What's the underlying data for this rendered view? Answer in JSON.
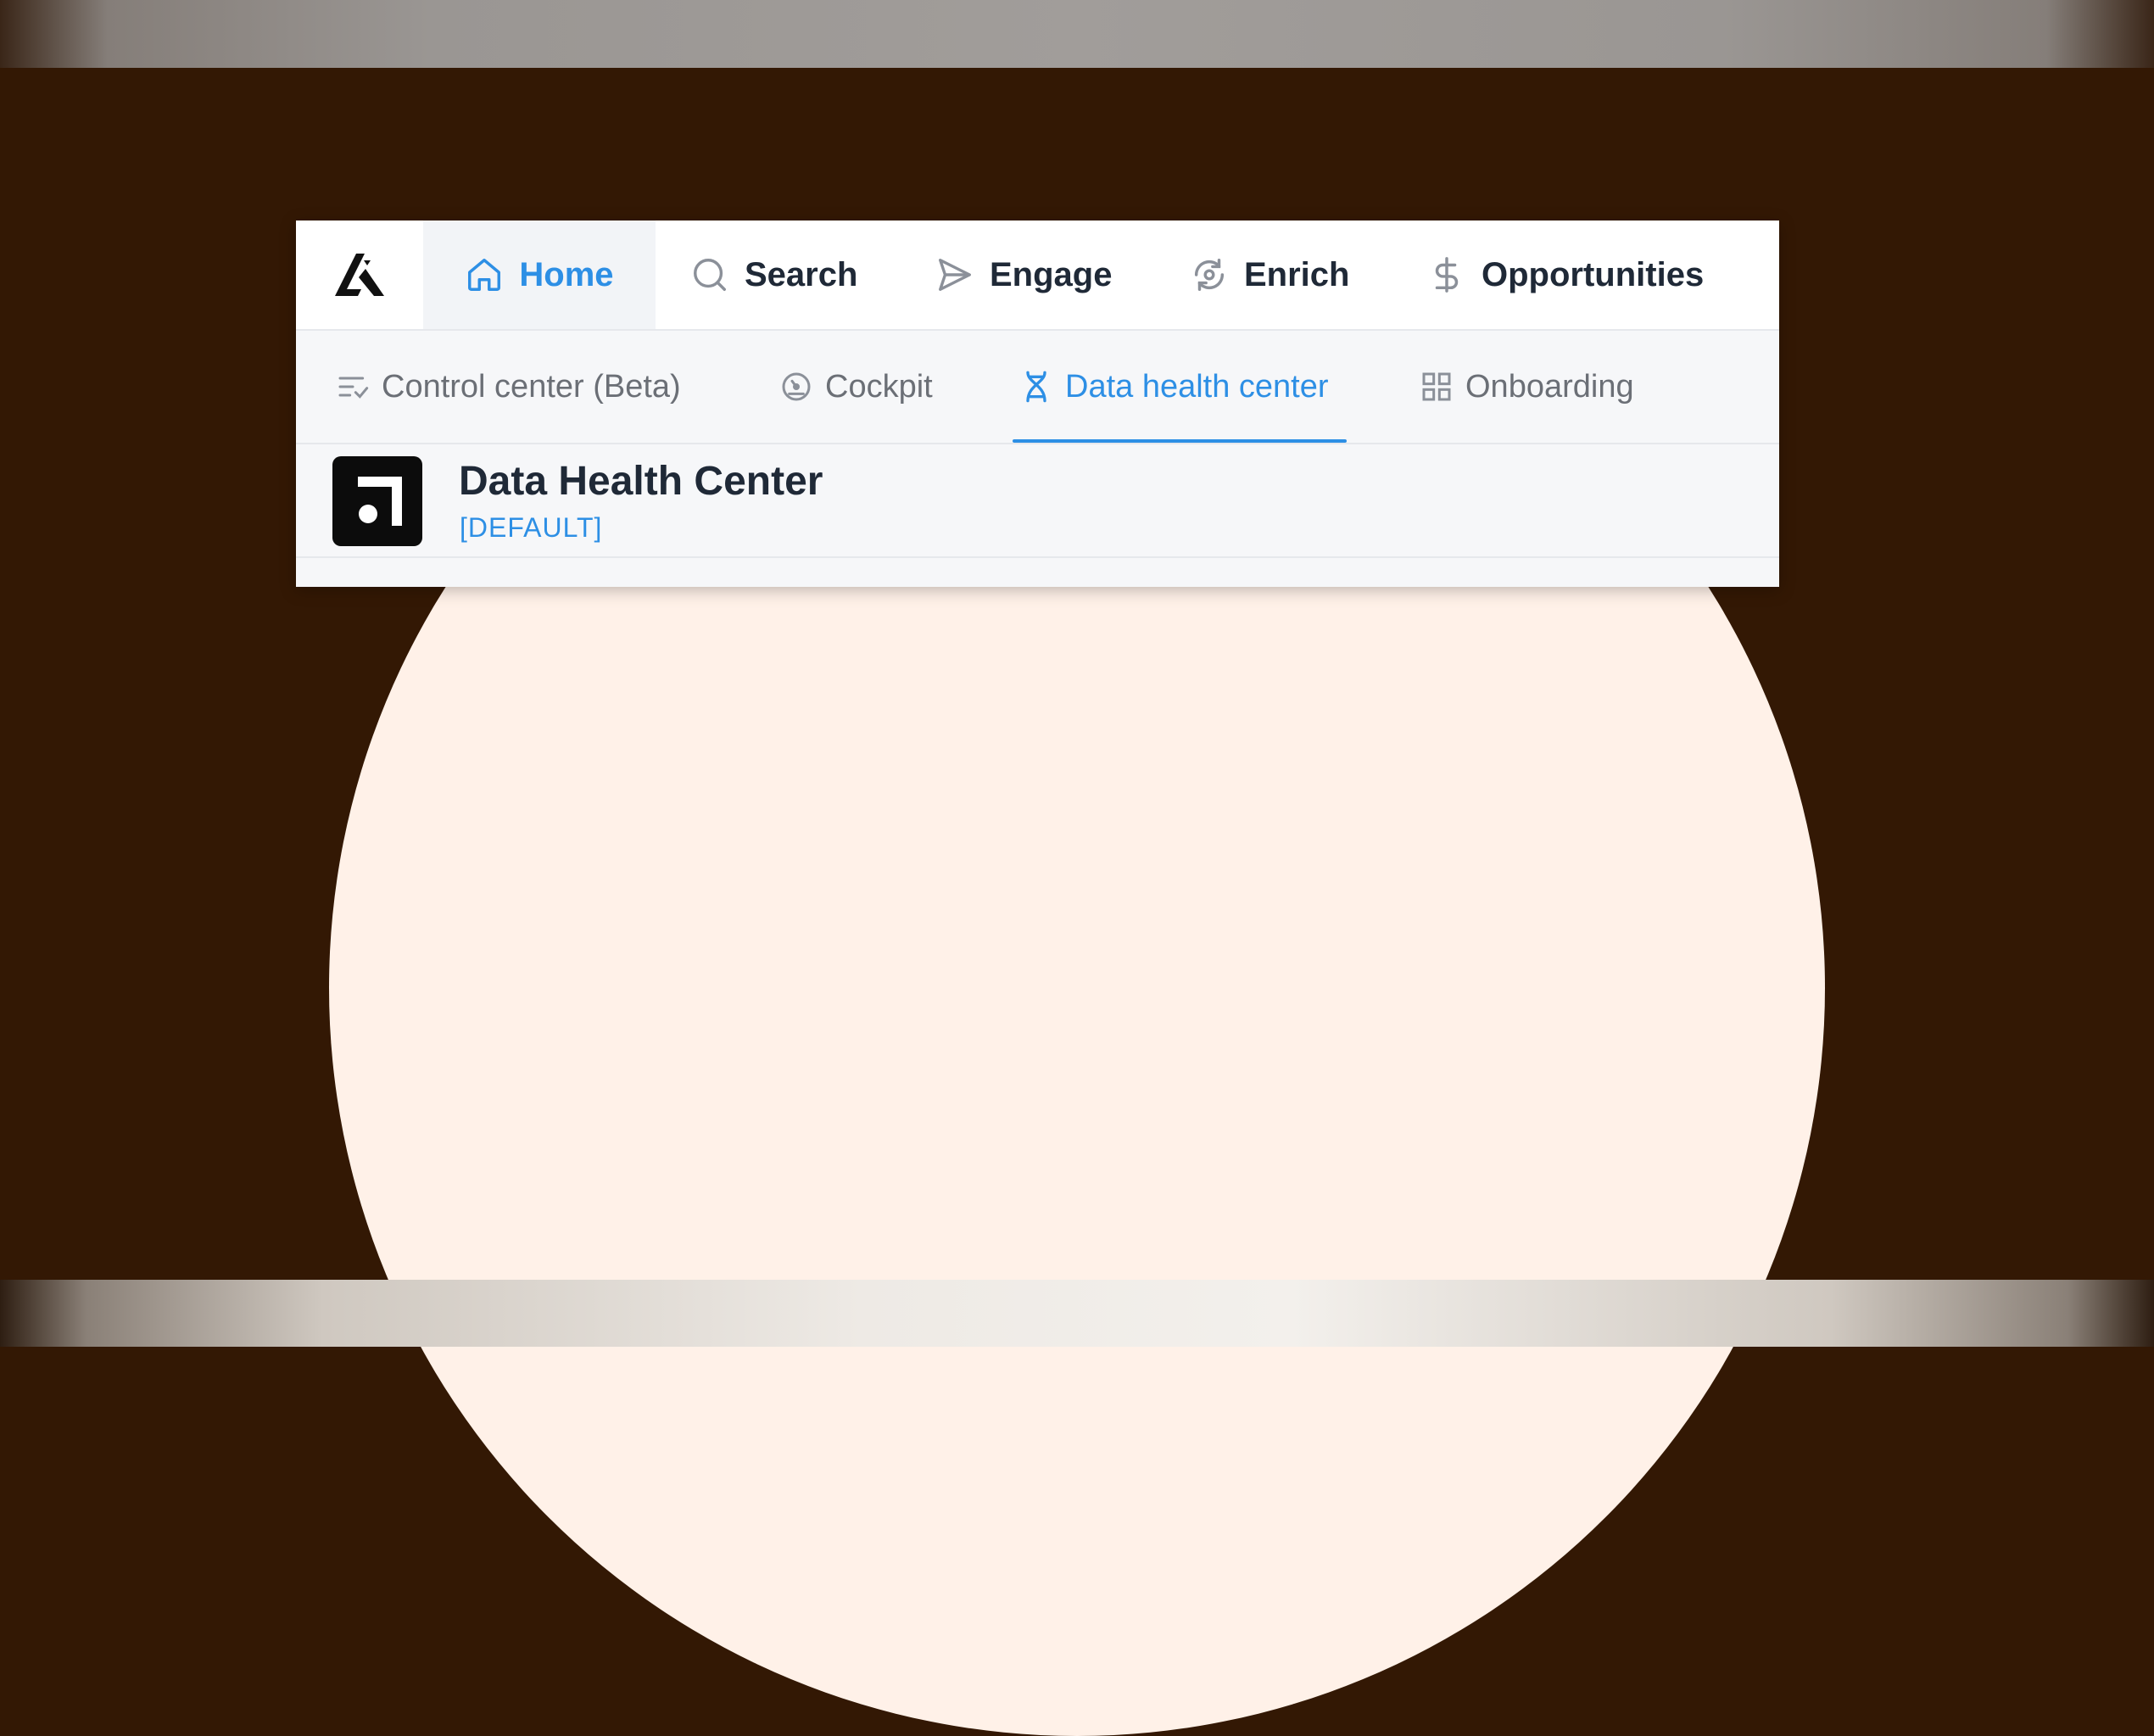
{
  "nav": {
    "items": [
      {
        "label": "Home",
        "icon": "home-icon",
        "active": true
      },
      {
        "label": "Search",
        "icon": "search-icon",
        "active": false
      },
      {
        "label": "Engage",
        "icon": "send-icon",
        "active": false
      },
      {
        "label": "Enrich",
        "icon": "refresh-icon",
        "active": false
      },
      {
        "label": "Opportunities",
        "icon": "dollar-icon",
        "active": false
      }
    ]
  },
  "subnav": {
    "items": [
      {
        "label": "Control center (Beta)",
        "icon": "checklist-icon",
        "active": false
      },
      {
        "label": "Cockpit",
        "icon": "gauge-icon",
        "active": false
      },
      {
        "label": "Data health center",
        "icon": "dna-icon",
        "active": true
      },
      {
        "label": "Onboarding",
        "icon": "grid-icon",
        "active": false
      }
    ]
  },
  "header": {
    "title": "Data Health Center",
    "tag": "[DEFAULT]",
    "logo_icon": "square-mark-icon"
  },
  "colors": {
    "accent": "#2d8fe5",
    "background": "#331804",
    "circle": "#fff1e8",
    "text_dark": "#1f2937",
    "text_muted": "#6b6f76"
  }
}
